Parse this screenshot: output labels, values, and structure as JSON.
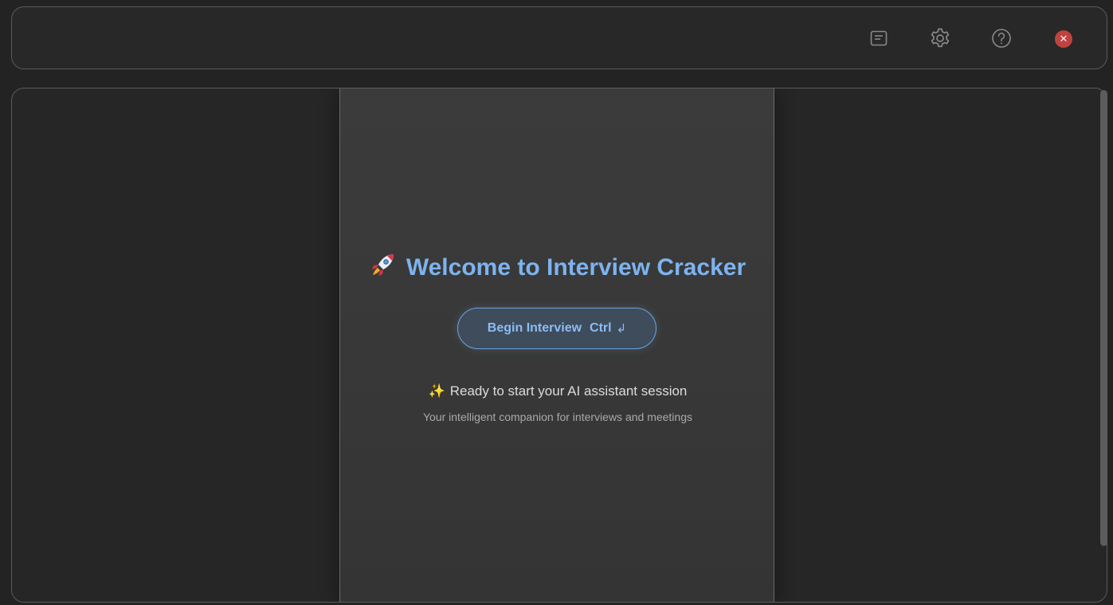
{
  "toolbar": {
    "notes_icon": "notes-icon",
    "settings_icon": "gear-icon",
    "help_icon": "help-icon",
    "close_glyph": "✕"
  },
  "welcome": {
    "emoji": "🚀",
    "title": "Welcome to Interview Cracker"
  },
  "begin_button": {
    "label": "Begin Interview",
    "shortcut": "Ctrl",
    "enter_glyph": "↲"
  },
  "status": {
    "emoji": "✨",
    "text": "Ready to start your AI assistant session",
    "subtext": "Your intelligent companion for interviews and meetings"
  },
  "colors": {
    "accent": "#7db3ef",
    "close": "#c0423f",
    "background": "#232323"
  }
}
